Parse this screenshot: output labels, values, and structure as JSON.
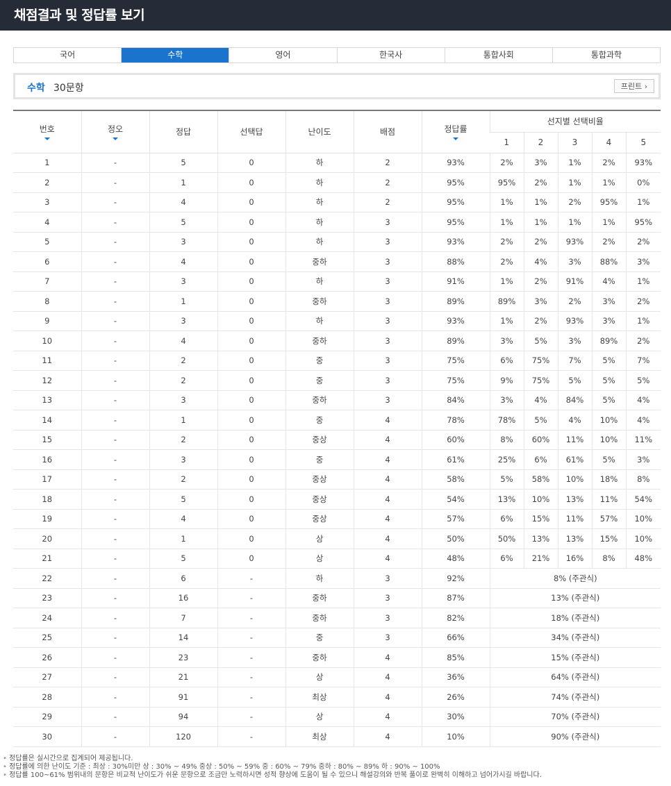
{
  "page_title": "채점결과 및 정답률 보기",
  "tabs": [
    "국어",
    "수학",
    "영어",
    "한국사",
    "통합사회",
    "통합과학"
  ],
  "active_tab": 1,
  "subject": {
    "name": "수학",
    "count": "30문항",
    "print_label": "프린트"
  },
  "table": {
    "headers": {
      "number": "번호",
      "correct_wrong": "정오",
      "answer": "정답",
      "selected": "선택답",
      "difficulty": "난이도",
      "points": "배점",
      "rate": "정답률",
      "choice_ratio": "선지별 선택비율",
      "choices": [
        "1",
        "2",
        "3",
        "4",
        "5"
      ]
    },
    "rows": [
      {
        "no": "1",
        "ox": "-",
        "ans": "5",
        "sel": "0",
        "diff": "하",
        "pts": "2",
        "rate": "93%",
        "choices": [
          "2%",
          "3%",
          "1%",
          "2%",
          "93%"
        ]
      },
      {
        "no": "2",
        "ox": "-",
        "ans": "1",
        "sel": "0",
        "diff": "하",
        "pts": "2",
        "rate": "95%",
        "choices": [
          "95%",
          "2%",
          "1%",
          "1%",
          "0%"
        ]
      },
      {
        "no": "3",
        "ox": "-",
        "ans": "4",
        "sel": "0",
        "diff": "하",
        "pts": "2",
        "rate": "95%",
        "choices": [
          "1%",
          "1%",
          "2%",
          "95%",
          "1%"
        ]
      },
      {
        "no": "4",
        "ox": "-",
        "ans": "5",
        "sel": "0",
        "diff": "하",
        "pts": "3",
        "rate": "95%",
        "choices": [
          "1%",
          "1%",
          "1%",
          "1%",
          "95%"
        ]
      },
      {
        "no": "5",
        "ox": "-",
        "ans": "3",
        "sel": "0",
        "diff": "하",
        "pts": "3",
        "rate": "93%",
        "choices": [
          "2%",
          "2%",
          "93%",
          "2%",
          "2%"
        ]
      },
      {
        "no": "6",
        "ox": "-",
        "ans": "4",
        "sel": "0",
        "diff": "중하",
        "pts": "3",
        "rate": "88%",
        "choices": [
          "2%",
          "4%",
          "3%",
          "88%",
          "3%"
        ]
      },
      {
        "no": "7",
        "ox": "-",
        "ans": "3",
        "sel": "0",
        "diff": "하",
        "pts": "3",
        "rate": "91%",
        "choices": [
          "1%",
          "2%",
          "91%",
          "4%",
          "1%"
        ]
      },
      {
        "no": "8",
        "ox": "-",
        "ans": "1",
        "sel": "0",
        "diff": "중하",
        "pts": "3",
        "rate": "89%",
        "choices": [
          "89%",
          "3%",
          "2%",
          "3%",
          "2%"
        ]
      },
      {
        "no": "9",
        "ox": "-",
        "ans": "3",
        "sel": "0",
        "diff": "하",
        "pts": "3",
        "rate": "93%",
        "choices": [
          "1%",
          "2%",
          "93%",
          "3%",
          "1%"
        ]
      },
      {
        "no": "10",
        "ox": "-",
        "ans": "4",
        "sel": "0",
        "diff": "중하",
        "pts": "3",
        "rate": "89%",
        "choices": [
          "3%",
          "5%",
          "3%",
          "89%",
          "2%"
        ]
      },
      {
        "no": "11",
        "ox": "-",
        "ans": "2",
        "sel": "0",
        "diff": "중",
        "pts": "3",
        "rate": "75%",
        "choices": [
          "6%",
          "75%",
          "7%",
          "5%",
          "7%"
        ]
      },
      {
        "no": "12",
        "ox": "-",
        "ans": "2",
        "sel": "0",
        "diff": "중",
        "pts": "3",
        "rate": "75%",
        "choices": [
          "9%",
          "75%",
          "5%",
          "5%",
          "5%"
        ]
      },
      {
        "no": "13",
        "ox": "-",
        "ans": "3",
        "sel": "0",
        "diff": "중하",
        "pts": "3",
        "rate": "84%",
        "choices": [
          "3%",
          "4%",
          "84%",
          "5%",
          "4%"
        ]
      },
      {
        "no": "14",
        "ox": "-",
        "ans": "1",
        "sel": "0",
        "diff": "중",
        "pts": "4",
        "rate": "78%",
        "choices": [
          "78%",
          "5%",
          "4%",
          "10%",
          "4%"
        ]
      },
      {
        "no": "15",
        "ox": "-",
        "ans": "2",
        "sel": "0",
        "diff": "중상",
        "pts": "4",
        "rate": "60%",
        "choices": [
          "8%",
          "60%",
          "11%",
          "10%",
          "11%"
        ]
      },
      {
        "no": "16",
        "ox": "-",
        "ans": "3",
        "sel": "0",
        "diff": "중",
        "pts": "4",
        "rate": "61%",
        "choices": [
          "25%",
          "6%",
          "61%",
          "5%",
          "3%"
        ]
      },
      {
        "no": "17",
        "ox": "-",
        "ans": "2",
        "sel": "0",
        "diff": "중상",
        "pts": "4",
        "rate": "58%",
        "choices": [
          "5%",
          "58%",
          "10%",
          "18%",
          "8%"
        ]
      },
      {
        "no": "18",
        "ox": "-",
        "ans": "5",
        "sel": "0",
        "diff": "중상",
        "pts": "4",
        "rate": "54%",
        "choices": [
          "13%",
          "10%",
          "13%",
          "11%",
          "54%"
        ]
      },
      {
        "no": "19",
        "ox": "-",
        "ans": "4",
        "sel": "0",
        "diff": "중상",
        "pts": "4",
        "rate": "57%",
        "choices": [
          "6%",
          "15%",
          "11%",
          "57%",
          "10%"
        ]
      },
      {
        "no": "20",
        "ox": "-",
        "ans": "1",
        "sel": "0",
        "diff": "상",
        "pts": "4",
        "rate": "50%",
        "choices": [
          "50%",
          "13%",
          "13%",
          "15%",
          "10%"
        ]
      },
      {
        "no": "21",
        "ox": "-",
        "ans": "5",
        "sel": "0",
        "diff": "상",
        "pts": "4",
        "rate": "48%",
        "choices": [
          "6%",
          "21%",
          "16%",
          "8%",
          "48%"
        ]
      },
      {
        "no": "22",
        "ox": "-",
        "ans": "6",
        "sel": "-",
        "diff": "하",
        "pts": "3",
        "rate": "92%",
        "subjective": "8% (주관식)"
      },
      {
        "no": "23",
        "ox": "-",
        "ans": "16",
        "sel": "-",
        "diff": "중하",
        "pts": "3",
        "rate": "87%",
        "subjective": "13% (주관식)"
      },
      {
        "no": "24",
        "ox": "-",
        "ans": "7",
        "sel": "-",
        "diff": "중하",
        "pts": "3",
        "rate": "82%",
        "subjective": "18% (주관식)"
      },
      {
        "no": "25",
        "ox": "-",
        "ans": "14",
        "sel": "-",
        "diff": "중",
        "pts": "3",
        "rate": "66%",
        "subjective": "34% (주관식)"
      },
      {
        "no": "26",
        "ox": "-",
        "ans": "23",
        "sel": "-",
        "diff": "중하",
        "pts": "4",
        "rate": "85%",
        "subjective": "15% (주관식)"
      },
      {
        "no": "27",
        "ox": "-",
        "ans": "21",
        "sel": "-",
        "diff": "상",
        "pts": "4",
        "rate": "36%",
        "subjective": "64% (주관식)"
      },
      {
        "no": "28",
        "ox": "-",
        "ans": "91",
        "sel": "-",
        "diff": "최상",
        "pts": "4",
        "rate": "26%",
        "subjective": "74% (주관식)"
      },
      {
        "no": "29",
        "ox": "-",
        "ans": "94",
        "sel": "-",
        "diff": "상",
        "pts": "4",
        "rate": "30%",
        "subjective": "70% (주관식)"
      },
      {
        "no": "30",
        "ox": "-",
        "ans": "120",
        "sel": "-",
        "diff": "최상",
        "pts": "4",
        "rate": "10%",
        "subjective": "90% (주관식)"
      }
    ]
  },
  "notes": [
    "정답률은 실시간으로 집계되어 제공됩니다.",
    "정답률에 의한 난이도 기준 : 최상 : 30%미만 상 : 30% ~ 49% 중상 : 50% ~ 59% 중 : 60% ~ 79% 중하 : 80% ~ 89% 하 : 90% ~ 100%",
    "정답률 100~61% 범위내의 문항은 비교적 난이도가 쉬운 문항으로 조금만 노력하시면 성적 향상에 도움이 될 수 있으니 해설강의와 반복 풀이로 완벽히 이해하고 넘어가시길 바랍니다."
  ],
  "colors": {
    "header_bg": "#252c38",
    "accent": "#1a73cc"
  }
}
